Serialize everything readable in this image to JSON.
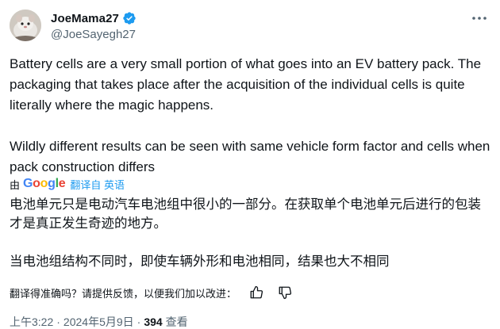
{
  "author": {
    "display_name": "JoeMama27",
    "handle": "@JoeSayegh27"
  },
  "tweet": {
    "text": "Battery cells are a very small portion of what goes into an EV battery pack. The packaging that takes place after the acquisition of the individual cells is quite literally where the magic happens.\n\nWildly different results can be seen with same vehicle form factor and cells when pack construction differs"
  },
  "translation": {
    "by_label": "由",
    "provider": "Google",
    "from_label": "翻译自 英语",
    "text": "电池单元只是电动汽车电池组中很小的一部分。在获取单个电池单元后进行的包装才是真正发生奇迹的地方。\n\n当电池组结构不同时，即使车辆外形和电池相同，结果也大不相同",
    "feedback_prompt": "翻译得准确吗？请提供反馈，以便我们加以改进："
  },
  "meta": {
    "time": "上午3:22",
    "separator": "·",
    "date": "2024年5月9日",
    "views_count": "394",
    "views_label": "查看"
  },
  "colors": {
    "verified": "#1d9bf0",
    "link": "#1d9bf0",
    "secondary_text": "#536471"
  },
  "icons": [
    "avatar",
    "verified-badge-icon",
    "more-options-icon",
    "thumbs-up-icon",
    "thumbs-down-icon"
  ]
}
